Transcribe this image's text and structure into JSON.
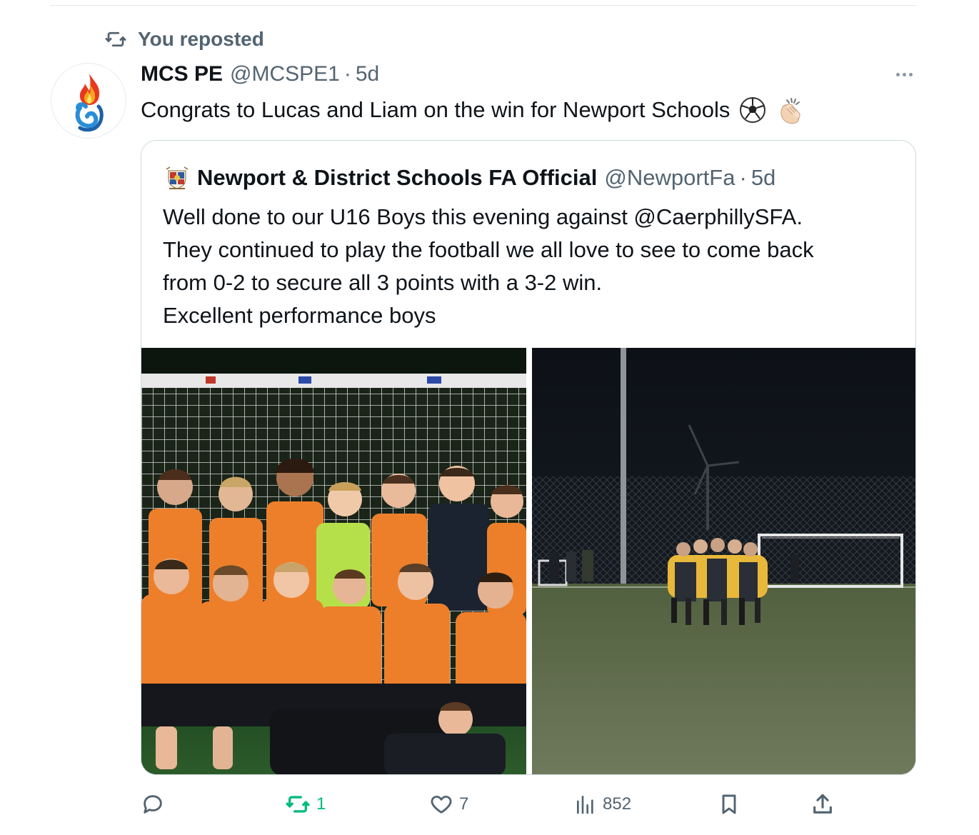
{
  "social_context": {
    "label": "You reposted",
    "icon": "repost-icon"
  },
  "post": {
    "author_name": "MCS PE",
    "author_handle": "@MCSPE1",
    "separator": "·",
    "time": "5d",
    "text": "Congrats to Lucas and Liam on the win for Newport Schools",
    "emojis": [
      "soccer-ball-icon",
      "clapping-hands-icon"
    ],
    "more_icon": "more-options-icon"
  },
  "quote": {
    "author_name": "Newport & District Schools FA Official",
    "author_handle": "@NewportFa",
    "separator": "·",
    "time": "5d",
    "text_lines": [
      "Well done to our U16 Boys this evening against @CaerphillySFA.",
      "They continued to play the football we all love to see to come back",
      "from 0-2 to secure all 3 points with a 3-2 win.",
      "Excellent performance boys"
    ],
    "media": [
      {
        "name": "team-photo",
        "kind": "photo"
      },
      {
        "name": "huddle-photo",
        "kind": "photo"
      }
    ]
  },
  "actions": {
    "reply": {
      "icon": "reply-icon",
      "count": ""
    },
    "repost": {
      "icon": "repost-icon",
      "count": "1",
      "color": "#00ba7c"
    },
    "like": {
      "icon": "heart-icon",
      "count": "7"
    },
    "views": {
      "icon": "views-chart-icon",
      "count": "852"
    },
    "bookmark": {
      "icon": "bookmark-icon",
      "count": ""
    },
    "share": {
      "icon": "share-icon",
      "count": ""
    }
  },
  "colors": {
    "secondary_text": "#536471",
    "repost_green": "#00ba7c",
    "border": "#cfd9de",
    "jersey_orange": "#ee7f2a"
  }
}
